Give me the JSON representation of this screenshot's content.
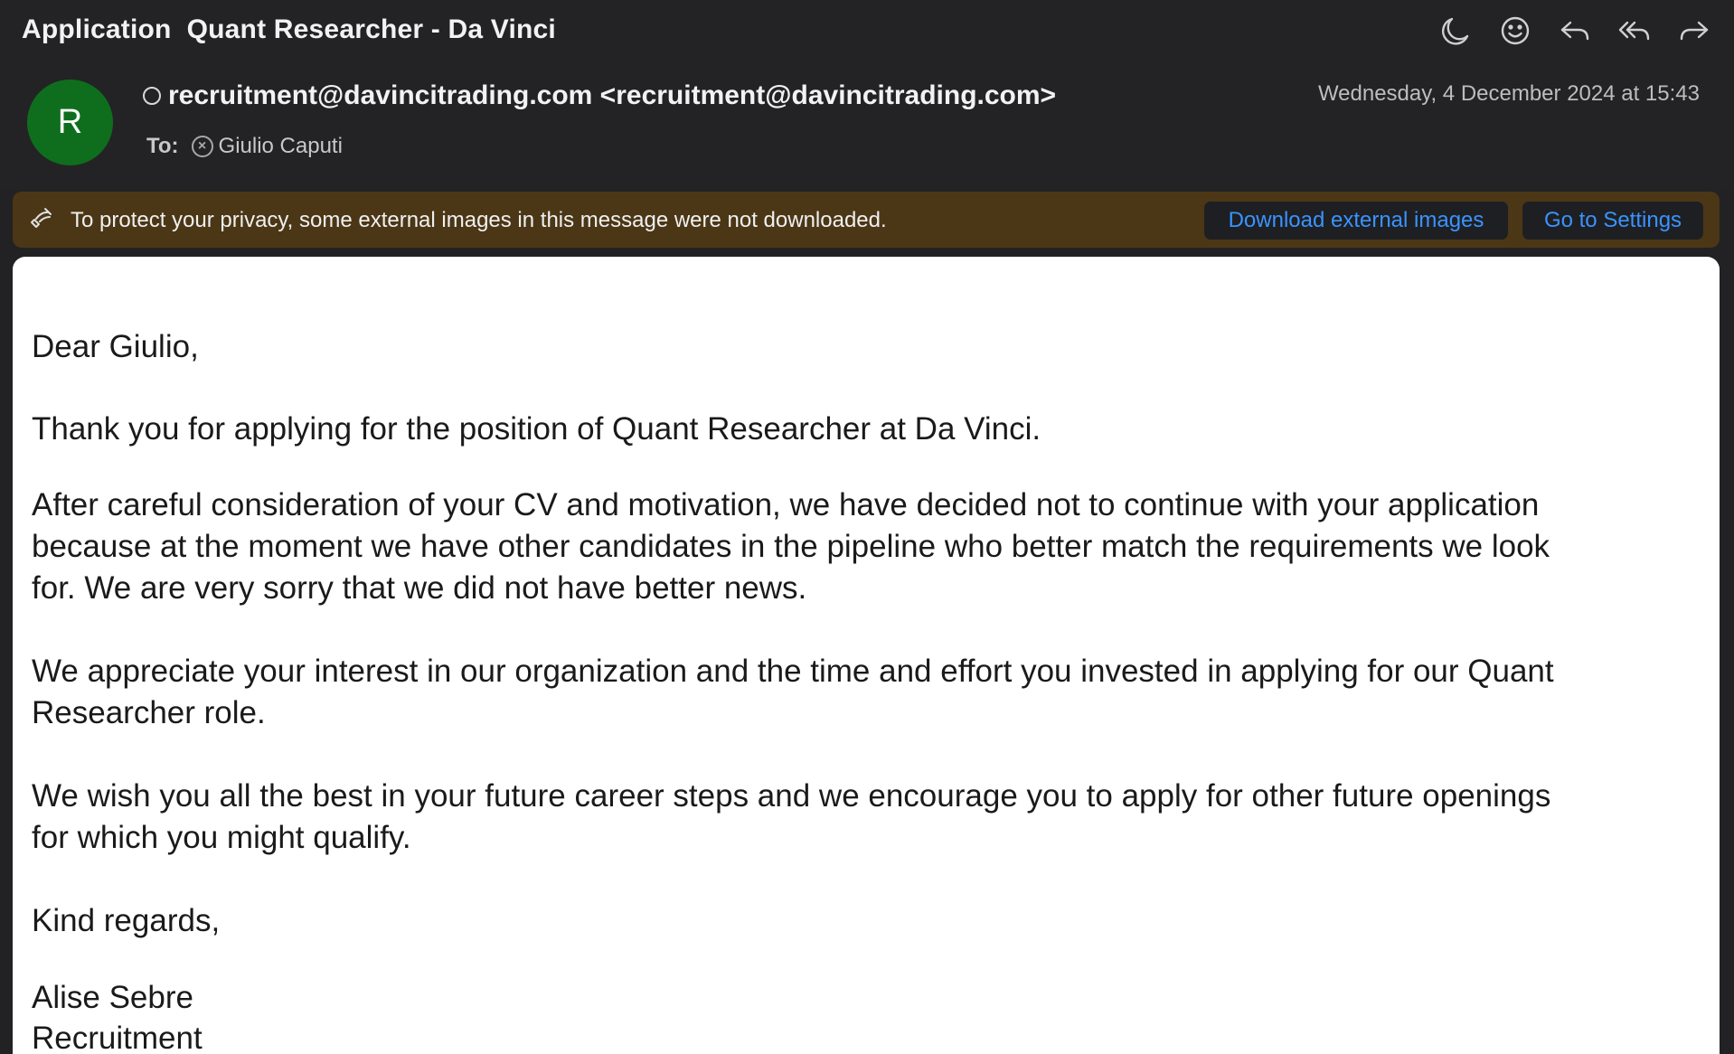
{
  "email": {
    "subject": "Application  Quant Researcher - Da Vinci",
    "toolbar": [
      "moon-icon",
      "emoji-icon",
      "reply-icon",
      "reply-all-icon",
      "forward-icon"
    ],
    "sender": {
      "avatar_initial": "R",
      "avatar_color": "#0f6e1d",
      "display": "recruitment@davincitrading.com <recruitment@davincitrading.com>"
    },
    "date": "Wednesday, 4 December 2024 at 15:43",
    "to_label": "To:",
    "recipient": "Giulio Caputi"
  },
  "banner": {
    "text": "To protect your privacy, some external images in this message were not downloaded.",
    "download_label": "Download external images",
    "settings_label": "Go to Settings",
    "background": "#4b3716",
    "link_color": "#3a93ff"
  },
  "body": {
    "greeting": "Dear Giulio,",
    "p1": "Thank you for applying for the position of Quant Researcher at Da Vinci.",
    "p2_line1": "After careful consideration of your CV and motivation, we have decided not to continue with your application",
    "p2_line2": "because at the moment we have other candidates in the pipeline who better match the requirements we look",
    "p2_line3": "for. We are very sorry that we did not have better news.",
    "p3_line1": "We appreciate your interest in our organization and the time and effort you invested in applying for our Quant",
    "p3_line2": "Researcher role.",
    "p4_line1": "We wish you all the best in your future career steps and we encourage you to apply for other future openings",
    "p4_line2": "for which you might qualify.",
    "closing": "Kind regards,",
    "signature_name": "Alise Sebre",
    "signature_dept": "Recruitment"
  }
}
